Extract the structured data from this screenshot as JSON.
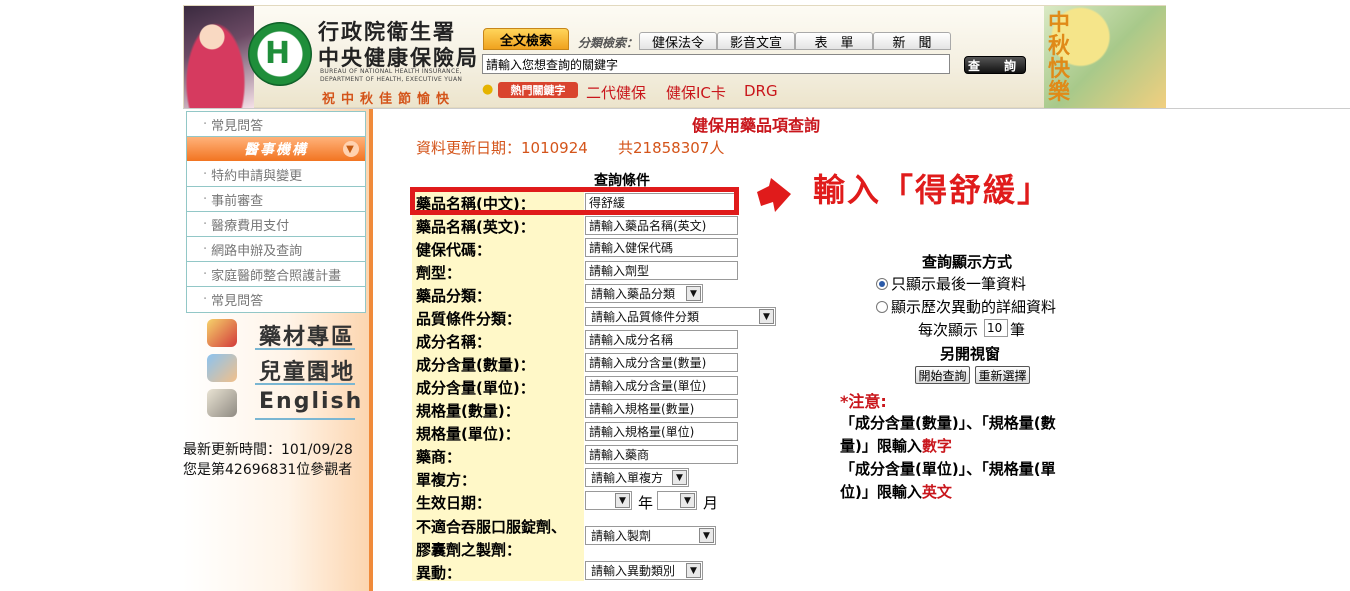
{
  "header": {
    "org_name_line1": "行政院衛生署",
    "org_name_line2": "中央健康保險局",
    "org_en_line1": "BUREAU OF NATIONAL HEALTH INSURANCE,",
    "org_en_line2": "DEPARTMENT OF HEALTH,  EXECUTIVE YUAN",
    "festival_text": "祝中秋佳節愉快",
    "fulltext_tab": "全文檢索",
    "category_label": "分類檢索：",
    "category_tabs": [
      "健保法令",
      "影音文宣",
      "表　單",
      "新　聞"
    ],
    "search_placeholder": "請輸入您想查詢的關鍵字",
    "search_button": "查　詢",
    "hot_keywords_badge": "熱門關鍵字",
    "hot_links": [
      "二代健保",
      "健保IC卡",
      "DRG"
    ],
    "banner_text": "中秋快樂"
  },
  "sidebar": {
    "top_item": "常見問答",
    "section_header": "醫事機構",
    "items": [
      "特約申請與變更",
      "事前審查",
      "醫療費用支付",
      "網路申辦及查詢",
      "家庭醫師整合照護計畫",
      "常見問答"
    ],
    "banners": [
      "藥材專區",
      "兒童園地",
      "English"
    ],
    "last_updated": "最新更新時間：101/09/28",
    "visitor_count": "您是第42696831位參觀者"
  },
  "main": {
    "page_title": "健保用藥品項查詢",
    "update_date": "資料更新日期：1010924",
    "total_count": "共21858307人",
    "conditions_title": "查詢條件",
    "fields": {
      "name_zh": {
        "label": "藥品名稱(中文)：",
        "value": "得舒緩"
      },
      "name_en": {
        "label": "藥品名稱(英文)：",
        "placeholder": "請輸入藥品名稱(英文)"
      },
      "nhi_code": {
        "label": "健保代碼：",
        "placeholder": "請輸入健保代碼"
      },
      "dosage_form": {
        "label": "劑型：",
        "placeholder": "請輸入劑型"
      },
      "drug_category": {
        "label": "藥品分類：",
        "selected": "請輸入藥品分類"
      },
      "quality_category": {
        "label": "品質條件分類：",
        "selected": "請輸入品質條件分類"
      },
      "ingredient_name": {
        "label": "成分名稱：",
        "placeholder": "請輸入成分名稱"
      },
      "ingredient_qty": {
        "label": "成分含量(數量)：",
        "placeholder": "請輸入成分含量(數量)"
      },
      "ingredient_unit": {
        "label": "成分含量(單位)：",
        "placeholder": "請輸入成分含量(單位)"
      },
      "spec_qty": {
        "label": "規格量(數量)：",
        "placeholder": "請輸入規格量(數量)"
      },
      "spec_unit": {
        "label": "規格量(單位)：",
        "placeholder": "請輸入規格量(單位)"
      },
      "manufacturer": {
        "label": "藥商：",
        "placeholder": "請輸入藥商"
      },
      "compound": {
        "label": "單複方：",
        "selected": "請輸入單複方"
      },
      "effective_date": {
        "label": "生效日期：",
        "year_unit": "年",
        "month_unit": "月"
      },
      "unsuitable": {
        "label_line1": "不適合吞服口服錠劑、",
        "label_line2": "膠囊劑之製劑：",
        "selected": "請輸入製劑"
      },
      "change": {
        "label": "異動：",
        "selected": "請輸入異動類別"
      }
    },
    "annotation": "輸入「得舒緩」"
  },
  "display_options": {
    "title": "查詢顯示方式",
    "radio_latest": "只顯示最後一筆資料",
    "radio_history": "顯示歷次異動的詳細資料",
    "selected": "latest",
    "per_page_label": "每次顯示",
    "per_page_value": "10",
    "per_page_unit": "筆",
    "new_window_label": "另開視窗",
    "start_button": "開始查詢",
    "reset_button": "重新選擇"
  },
  "notes": {
    "title": "*注意:",
    "line1_a": "「成分含量(數量)」、「規格量(數",
    "line2_a": "量)」限輸入",
    "line2_b": "數字",
    "line3_a": "「成分含量(單位)」、「規格量(單",
    "line4_a": "位)」限輸入",
    "line4_b": "英文"
  },
  "colors": {
    "accent_red": "#c9161c",
    "accent_orange": "#f27421",
    "form_label_bg": "#fff8c8",
    "highlight": "#e01b1b"
  }
}
